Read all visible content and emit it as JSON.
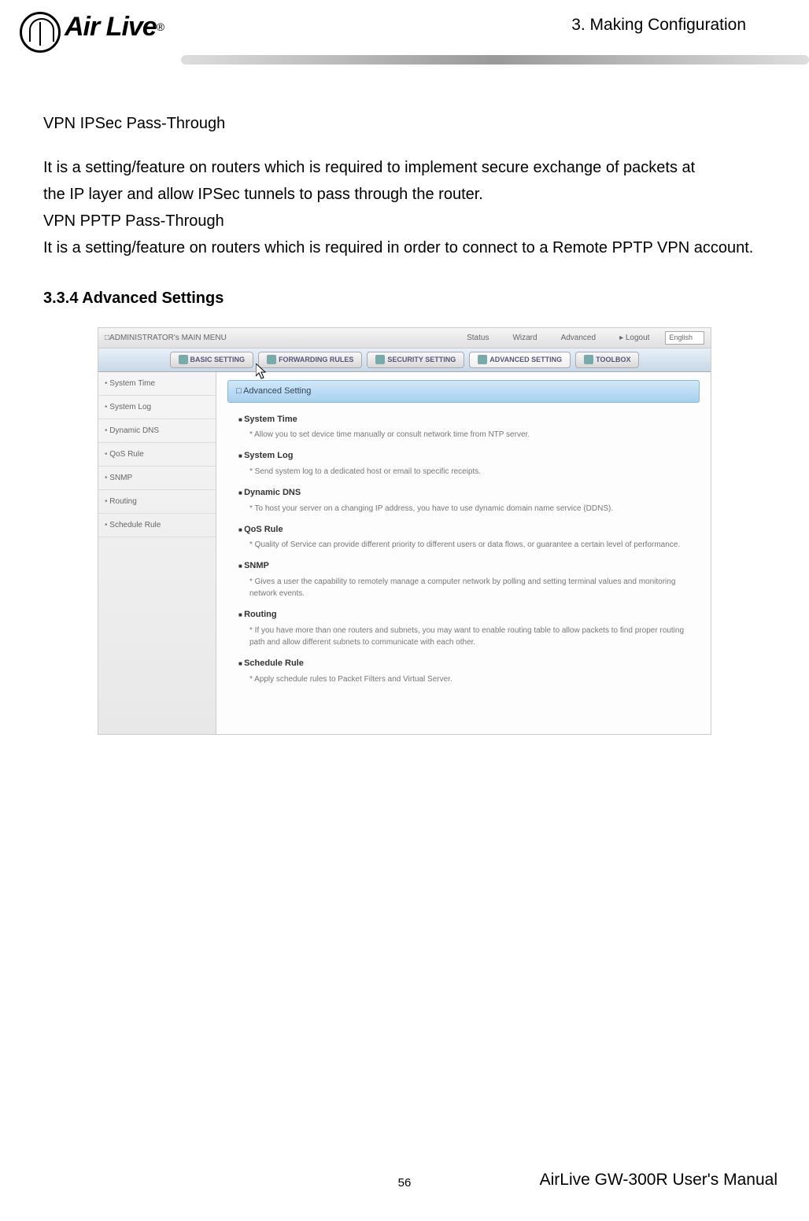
{
  "header": {
    "chapter": "3. Making Configuration",
    "logo_text": "Air Live",
    "logo_reg": "®"
  },
  "body": {
    "h1": "VPN IPSec Pass-Through",
    "p1a": "It is a setting/feature on routers which is required to implement secure exchange of packets at",
    "p1b": "the IP layer and allow IPSec tunnels to pass through the router.",
    "h2": "VPN PPTP Pass-Through",
    "p2": "It is a setting/feature on routers which is required in order to connect to a Remote PPTP VPN account.",
    "section_heading": "3.3.4 Advanced Settings"
  },
  "screenshot": {
    "toolbar_title": "ADMINISTRATOR's MAIN MENU",
    "toolbar_items": [
      "Status",
      "Wizard",
      "Advanced",
      "Logout"
    ],
    "language": "English",
    "tabs": [
      "BASIC SETTING",
      "FORWARDING RULES",
      "SECURITY SETTING",
      "ADVANCED SETTING",
      "TOOLBOX"
    ],
    "sidebar": [
      "System Time",
      "System Log",
      "Dynamic DNS",
      "QoS Rule",
      "SNMP",
      "Routing",
      "Schedule Rule"
    ],
    "panel_title": "Advanced Setting",
    "items": [
      {
        "title": "System Time",
        "desc": "Allow you to set device time manually or consult network time from NTP server."
      },
      {
        "title": "System Log",
        "desc": "Send system log to a dedicated host or email to specific receipts."
      },
      {
        "title": "Dynamic DNS",
        "desc": "To host your server on a changing IP address, you have to use dynamic domain name service (DDNS)."
      },
      {
        "title": "QoS Rule",
        "desc": "Quality of Service can provide different priority to different users or data flows, or guarantee a certain level of performance."
      },
      {
        "title": "SNMP",
        "desc": "Gives a user the capability to remotely manage a computer network by polling and setting terminal values and monitoring network events."
      },
      {
        "title": "Routing",
        "desc": "If you have more than one routers and subnets, you may want to enable routing table to allow packets to find proper routing path and allow different subnets to communicate with each other."
      },
      {
        "title": "Schedule Rule",
        "desc": "Apply schedule rules to Packet Filters and Virtual Server."
      }
    ]
  },
  "footer": {
    "page": "56",
    "manual": "AirLive GW-300R User's Manual"
  }
}
